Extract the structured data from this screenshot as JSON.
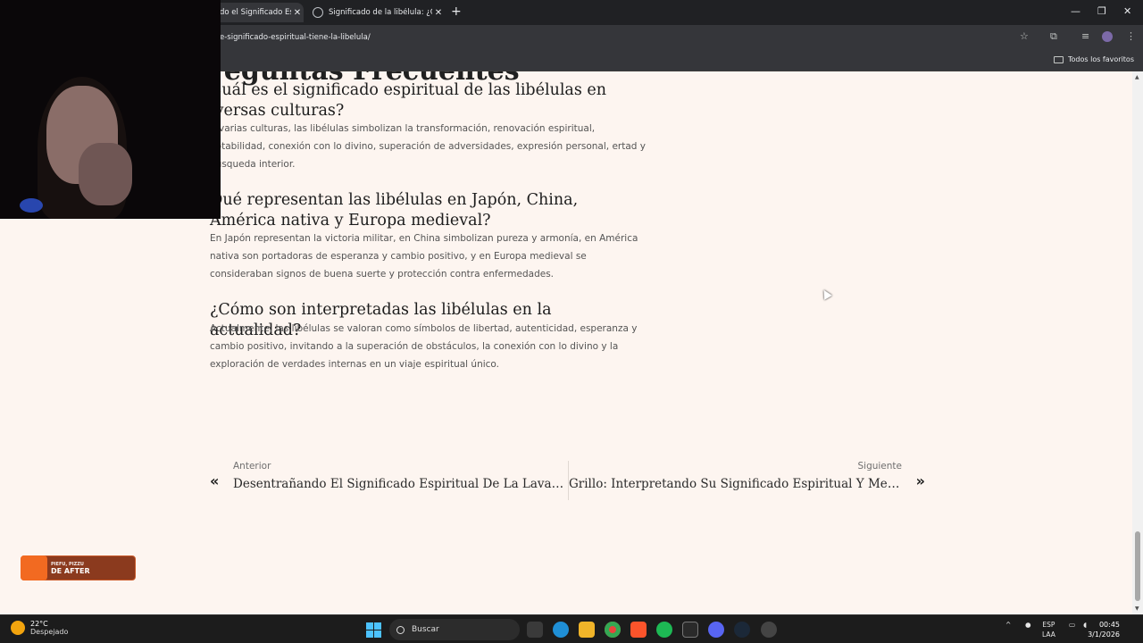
{
  "browser": {
    "tabs": [
      {
        "title": "do el Significado Es",
        "active": true
      },
      {
        "title": "Significado de la libélula: ¿Qué",
        "active": false
      }
    ],
    "url": "e-significado-espiritual-tiene-la-libelula/",
    "bookmarks_label": "Todos los favoritos"
  },
  "article": {
    "section_heading": "reguntas Frecuentes",
    "faqs": [
      {
        "question": "Cuál es el significado espiritual de las libélulas en iversas culturas?",
        "answer": "n varias culturas, las libélulas simbolizan la transformación, renovación espiritual, aptabilidad, conexión con lo divino, superación de adversidades, expresión personal, ertad y búsqueda interior."
      },
      {
        "question": "Qué representan las libélulas en Japón, China, América nativa y Europa medieval?",
        "answer": "En Japón representan la victoria militar, en China simbolizan pureza y armonía, en América nativa son portadoras de esperanza y cambio positivo, y en Europa medieval se consideraban signos de buena suerte y protección contra enfermedades."
      },
      {
        "question": "¿Cómo son interpretadas las libélulas en la actualidad?",
        "answer": "Actualmente, las libélulas se valoran como símbolos de libertad, autenticidad, esperanza y cambio positivo, invitando a la superación de obstáculos, la conexión con lo divino y la exploración de verdades internas en un viaje espiritual único."
      }
    ]
  },
  "post_nav": {
    "prev_label": "Anterior",
    "prev_title": "Desentrañando El Significado Espiritual De La Lavanda: ...",
    "next_label": "Siguiente",
    "next_title": "Grillo: Interpretando Su Significado Espiritual Y Mensaje..."
  },
  "overlay": {
    "line1": "PIEFU, PIZZU",
    "line2": "DE AFTER"
  },
  "taskbar": {
    "temp": "22°C",
    "weather": "Despejado",
    "search_label": "Buscar",
    "lang1": "ESP",
    "lang2": "LAA",
    "time": "00:45",
    "date": "3/1/2026"
  }
}
